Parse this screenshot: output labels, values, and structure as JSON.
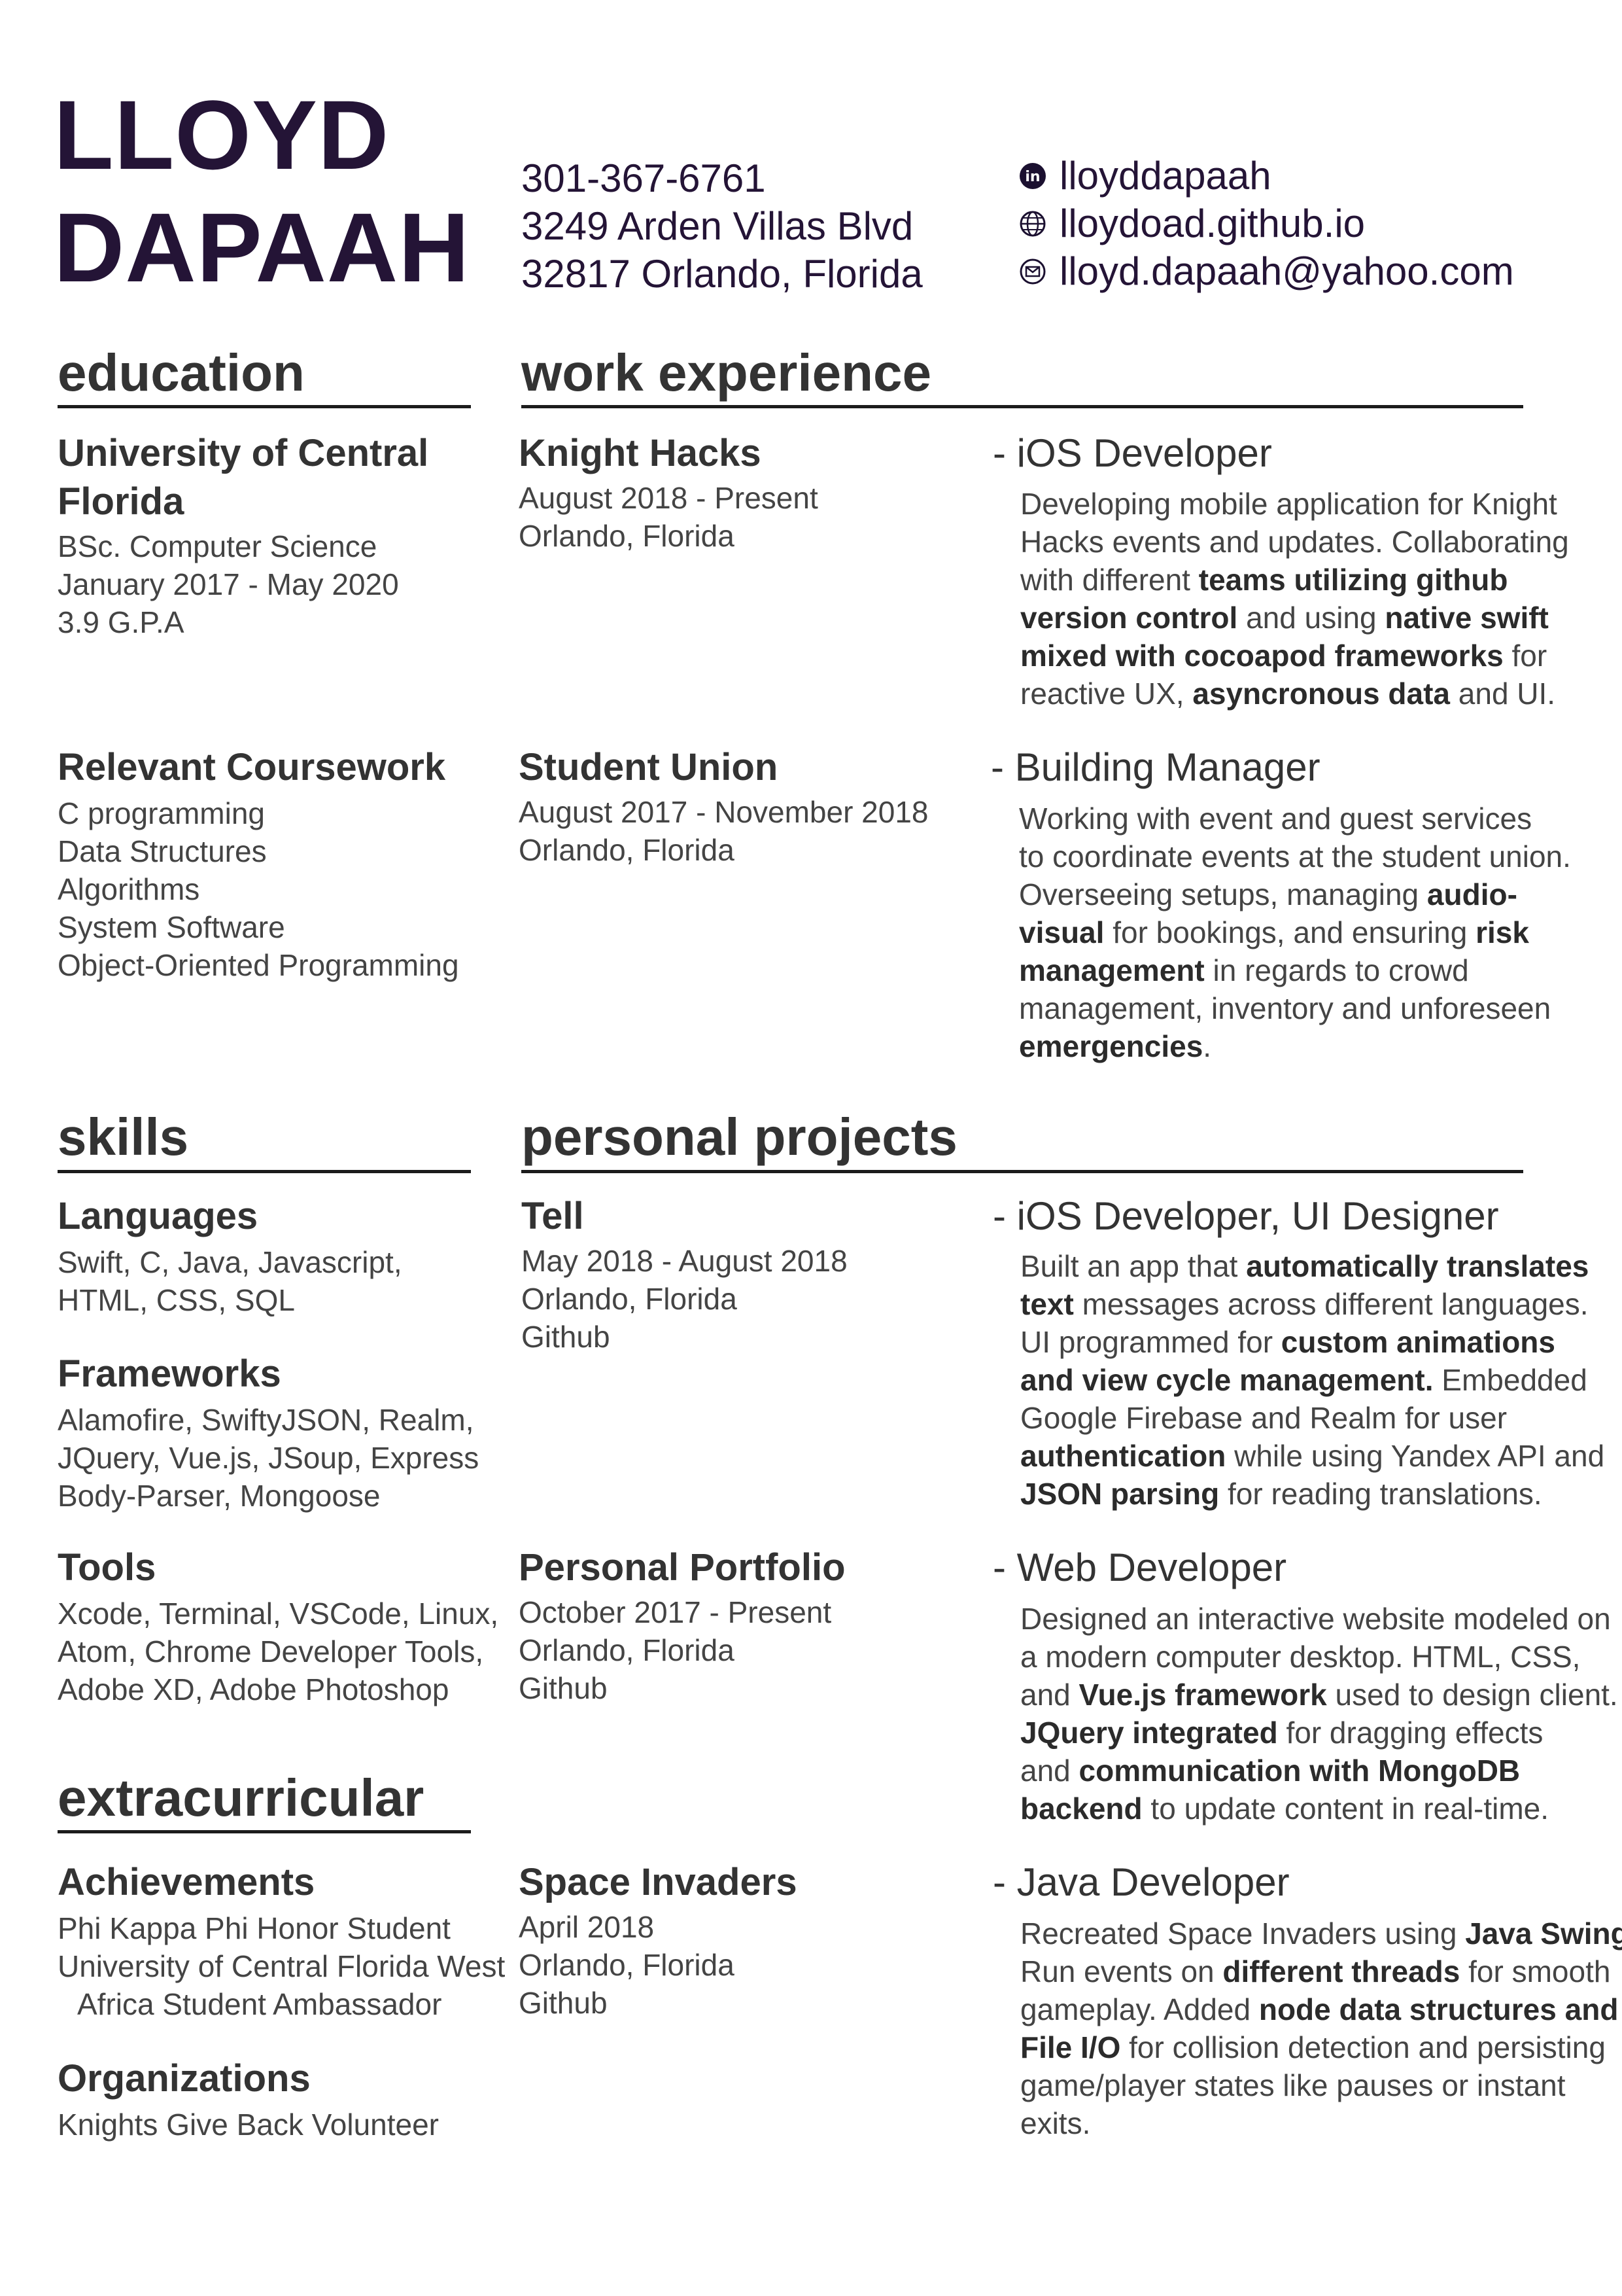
{
  "header": {
    "first_name": "LLOYD",
    "last_name": "DAPAAH",
    "phone": "301-367-6761",
    "address_line1": "3249 Arden Villas Blvd",
    "address_line2": "32817 Orlando, Florida",
    "linkedin": "lloyddapaah",
    "website": "lloydoad.github.io",
    "email": "lloyd.dapaah@yahoo.com",
    "icons": [
      "linkedin-icon",
      "globe-icon",
      "mail-icon"
    ],
    "name_color": "#241436"
  },
  "education": {
    "heading": "education",
    "school_line1": "University of Central",
    "school_line2": "Florida",
    "degree": "BSc. Computer Science",
    "dates": "January 2017 - May 2020",
    "gpa": "3.9 G.P.A",
    "coursework_heading": "Relevant Coursework",
    "courses": [
      "C programming",
      "Data Structures",
      "Algorithms",
      "System Software",
      "Object-Oriented Programming"
    ]
  },
  "work": {
    "heading": "work experience",
    "jobs": [
      {
        "org": "Knight Hacks",
        "dates": "August 2018 - Present",
        "location": "Orlando, Florida",
        "role": "- iOS Developer",
        "lines": [
          [
            {
              "t": "Developing mobile application  for Knight"
            }
          ],
          [
            {
              "t": "Hacks events and updates. Collaborating"
            }
          ],
          [
            {
              "t": "with different "
            },
            {
              "t": "teams utilizing github",
              "b": true
            }
          ],
          [
            {
              "t": "version control",
              "b": true
            },
            {
              "t": " and using "
            },
            {
              "t": "native swift",
              "b": true
            }
          ],
          [
            {
              "t": "mixed with cocoapod frameworks",
              "b": true
            },
            {
              "t": " for"
            }
          ],
          [
            {
              "t": "reactive UX, "
            },
            {
              "t": "asyncronous data",
              "b": true
            },
            {
              "t": " and UI."
            }
          ]
        ]
      },
      {
        "org": "Student Union",
        "dates": "August 2017 - November 2018",
        "location": "Orlando, Florida",
        "role": "- Building Manager",
        "lines": [
          [
            {
              "t": "Working with event and guest services"
            }
          ],
          [
            {
              "t": "to coordinate events at the student union."
            }
          ],
          [
            {
              "t": "Overseeing setups, managing "
            },
            {
              "t": "audio-",
              "b": true
            }
          ],
          [
            {
              "t": "visual",
              "b": true
            },
            {
              "t": " for bookings, and ensuring "
            },
            {
              "t": "risk",
              "b": true
            }
          ],
          [
            {
              "t": "management",
              "b": true
            },
            {
              "t": " in regards to crowd"
            }
          ],
          [
            {
              "t": "management, inventory and unforeseen"
            }
          ],
          [
            {
              "t": "emergencies",
              "b": true
            },
            {
              "t": "."
            }
          ]
        ]
      }
    ]
  },
  "skills": {
    "heading": "skills",
    "languages_heading": "Languages",
    "languages_line1": "Swift, C, Java, Javascript,",
    "languages_line2": "HTML, CSS,  SQL",
    "frameworks_heading": "Frameworks",
    "frameworks_line1": "Alamofire, SwiftyJSON, Realm,",
    "frameworks_line2": "JQuery, Vue.js, JSoup, Express",
    "frameworks_line3": "Body-Parser, Mongoose",
    "tools_heading": "Tools",
    "tools_line1": "Xcode, Terminal, VSCode, Linux,",
    "tools_line2": "Atom, Chrome Developer Tools,",
    "tools_line3": "Adobe XD, Adobe Photoshop"
  },
  "projects": {
    "heading": "personal projects",
    "items": [
      {
        "name": "Tell",
        "dates": "May 2018 - August 2018",
        "location": "Orlando, Florida",
        "link": "Github",
        "role": "- iOS Developer, UI Designer",
        "lines": [
          [
            {
              "t": "Built an app that "
            },
            {
              "t": "automatically translates",
              "b": true
            }
          ],
          [
            {
              "t": "text",
              "b": true
            },
            {
              "t": " messages across different languages."
            }
          ],
          [
            {
              "t": "UI programmed for "
            },
            {
              "t": "custom animations",
              "b": true
            }
          ],
          [
            {
              "t": "and view cycle management.",
              "b": true
            },
            {
              "t": " Embedded"
            }
          ],
          [
            {
              "t": "Google Firebase and Realm for user"
            }
          ],
          [
            {
              "t": "authentication",
              "b": true
            },
            {
              "t": " while using Yandex API and"
            }
          ],
          [
            {
              "t": "JSON parsing",
              "b": true
            },
            {
              "t": " for reading translations."
            }
          ]
        ]
      },
      {
        "name": "Personal Portfolio",
        "dates": "October 2017 - Present",
        "location": "Orlando, Florida",
        "link": "Github",
        "role": "- Web Developer",
        "lines": [
          [
            {
              "t": "Designed an interactive website modeled on"
            }
          ],
          [
            {
              "t": "a modern computer desktop. HTML, CSS,"
            }
          ],
          [
            {
              "t": "and "
            },
            {
              "t": "Vue.js framework",
              "b": true
            },
            {
              "t": " used to design client."
            }
          ],
          [
            {
              "t": "JQuery integrated",
              "b": true
            },
            {
              "t": " for dragging effects"
            }
          ],
          [
            {
              "t": "and "
            },
            {
              "t": "communication with MongoDB",
              "b": true
            }
          ],
          [
            {
              "t": "backend",
              "b": true
            },
            {
              "t": " to update content in real-time."
            }
          ]
        ]
      },
      {
        "name": "Space Invaders",
        "dates": "April 2018",
        "location": "Orlando, Florida",
        "link": "Github",
        "role": "- Java Developer",
        "lines": [
          [
            {
              "t": "Recreated Space Invaders using "
            },
            {
              "t": "Java Swing",
              "b": true
            },
            {
              "t": "."
            }
          ],
          [
            {
              "t": "Run events on "
            },
            {
              "t": "different threads",
              "b": true
            },
            {
              "t": " for smooth"
            }
          ],
          [
            {
              "t": "gameplay. Added "
            },
            {
              "t": "node data structures and",
              "b": true
            }
          ],
          [
            {
              "t": "File I/O",
              "b": true
            },
            {
              "t": " for collision detection and persisting"
            }
          ],
          [
            {
              "t": "game/player states like pauses or instant"
            }
          ],
          [
            {
              "t": "exits."
            }
          ]
        ]
      }
    ]
  },
  "extracurricular": {
    "heading": "extracurricular",
    "achievements_heading": "Achievements",
    "achievement1": "Phi Kappa Phi Honor Student",
    "achievement2_line1": "University of Central Florida West",
    "achievement2_line2": "Africa Student Ambassador",
    "organizations_heading": "Organizations",
    "organization1": "Knights Give Back Volunteer"
  }
}
